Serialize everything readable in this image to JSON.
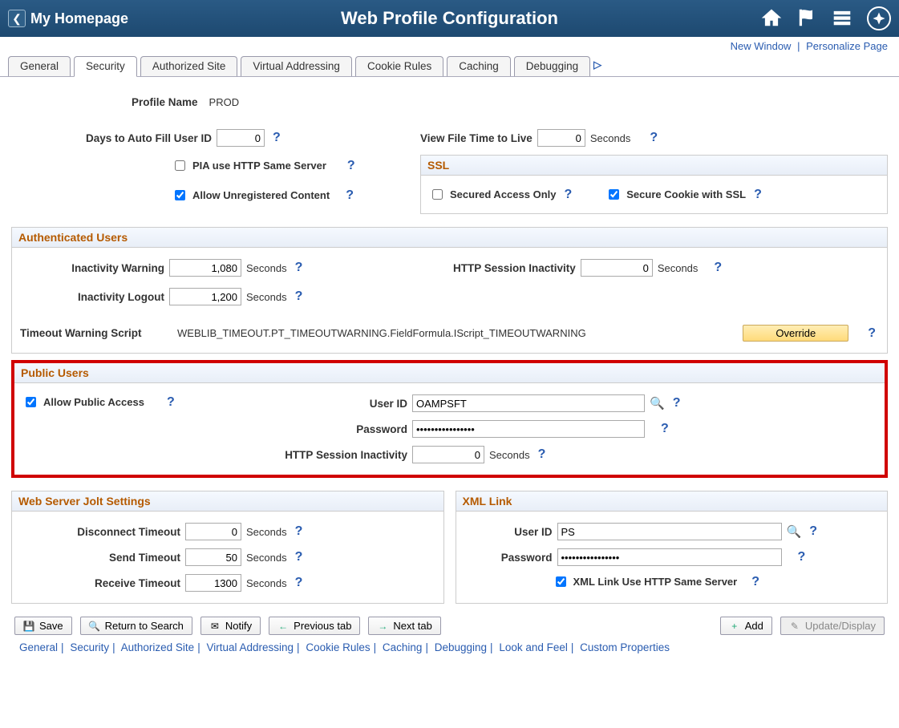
{
  "header": {
    "back_label": "My Homepage",
    "title": "Web Profile Configuration"
  },
  "toplinks": {
    "new_window": "New Window",
    "personalize": "Personalize Page"
  },
  "tabs": [
    "General",
    "Security",
    "Authorized Site",
    "Virtual Addressing",
    "Cookie Rules",
    "Caching",
    "Debugging"
  ],
  "active_tab": 1,
  "profile": {
    "name_label": "Profile Name",
    "name_value": "PROD"
  },
  "top_settings": {
    "days_autofill_label": "Days to Auto Fill User ID",
    "days_autofill_value": "0",
    "pia_same_server_label": "PIA use HTTP Same Server",
    "pia_same_server_checked": false,
    "allow_unreg_label": "Allow Unregistered Content",
    "allow_unreg_checked": true,
    "view_file_ttl_label": "View File Time to Live",
    "view_file_ttl_value": "0",
    "seconds_unit": "Seconds"
  },
  "ssl": {
    "title": "SSL",
    "secured_only_label": "Secured Access Only",
    "secured_only_checked": false,
    "secure_cookie_label": "Secure Cookie with SSL",
    "secure_cookie_checked": true
  },
  "auth_users": {
    "title": "Authenticated Users",
    "inactivity_warning_label": "Inactivity Warning",
    "inactivity_warning_value": "1,080",
    "inactivity_logout_label": "Inactivity Logout",
    "inactivity_logout_value": "1,200",
    "http_session_label": "HTTP Session Inactivity",
    "http_session_value": "0",
    "seconds_unit": "Seconds",
    "timeout_script_label": "Timeout Warning Script",
    "timeout_script_value": "WEBLIB_TIMEOUT.PT_TIMEOUTWARNING.FieldFormula.IScript_TIMEOUTWARNING",
    "override_btn": "Override"
  },
  "public_users": {
    "title": "Public Users",
    "allow_public_label": "Allow Public Access",
    "allow_public_checked": true,
    "user_id_label": "User ID",
    "user_id_value": "OAMPSFT",
    "password_label": "Password",
    "password_value": "••••••••••••••••",
    "http_session_label": "HTTP Session Inactivity",
    "http_session_value": "0",
    "seconds_unit": "Seconds"
  },
  "jolt": {
    "title": "Web Server Jolt Settings",
    "disconnect_label": "Disconnect Timeout",
    "disconnect_value": "0",
    "send_label": "Send Timeout",
    "send_value": "50",
    "receive_label": "Receive Timeout",
    "receive_value": "1300",
    "seconds_unit": "Seconds"
  },
  "xml_link": {
    "title": "XML Link",
    "user_id_label": "User ID",
    "user_id_value": "PS",
    "password_label": "Password",
    "password_value": "••••••••••••••••",
    "same_server_label": "XML Link Use HTTP Same Server",
    "same_server_checked": true
  },
  "buttons": {
    "save": "Save",
    "return": "Return to Search",
    "notify": "Notify",
    "prev_tab": "Previous tab",
    "next_tab": "Next tab",
    "add": "Add",
    "update": "Update/Display"
  },
  "footer_links": [
    "General",
    "Security",
    "Authorized Site",
    "Virtual Addressing",
    "Cookie Rules",
    "Caching",
    "Debugging",
    "Look and Feel",
    "Custom Properties"
  ]
}
